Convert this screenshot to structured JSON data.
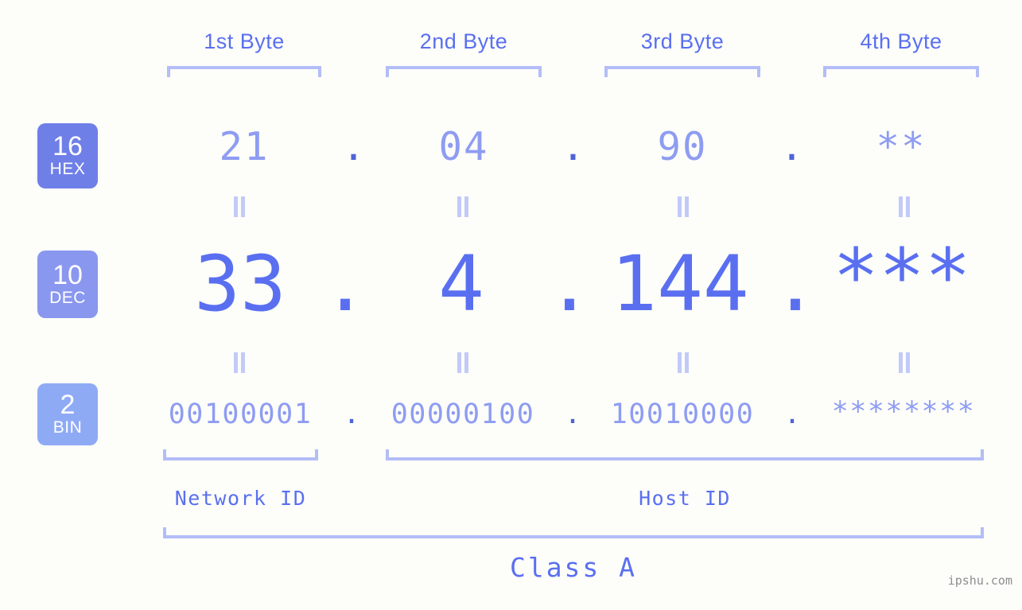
{
  "meta": {
    "background_color": "#fdfefa",
    "accent_color": "#5a6ff0",
    "light_accent_color": "#8e9cf2",
    "bracket_color": "#b3bdf7",
    "watermark": "ipshu.com"
  },
  "byte_headers": [
    {
      "label": "1st Byte"
    },
    {
      "label": "2nd Byte"
    },
    {
      "label": "3rd Byte"
    },
    {
      "label": "4th Byte"
    }
  ],
  "bases": [
    {
      "number": "16",
      "name": "HEX",
      "color": "#6f7fe8"
    },
    {
      "number": "10",
      "name": "DEC",
      "color": "#8a97ef"
    },
    {
      "number": "2",
      "name": "BIN",
      "color": "#8faaf5"
    }
  ],
  "rows": {
    "hex": {
      "base_number": "16",
      "base_name": "HEX",
      "values": [
        "21",
        "04",
        "90",
        "**"
      ],
      "separator": "."
    },
    "dec": {
      "base_number": "10",
      "base_name": "DEC",
      "values": [
        "33",
        "4",
        "144",
        "***"
      ],
      "separator": "."
    },
    "bin": {
      "base_number": "2",
      "base_name": "BIN",
      "values": [
        "00100001",
        "00000100",
        "10010000",
        "********"
      ],
      "separator": "."
    }
  },
  "equality_marks": {
    "symbol": "=",
    "count_per_gap": 4
  },
  "id_sections": [
    {
      "label": "Network ID"
    },
    {
      "label": "Host ID"
    }
  ],
  "class_section": {
    "label": "Class A"
  }
}
